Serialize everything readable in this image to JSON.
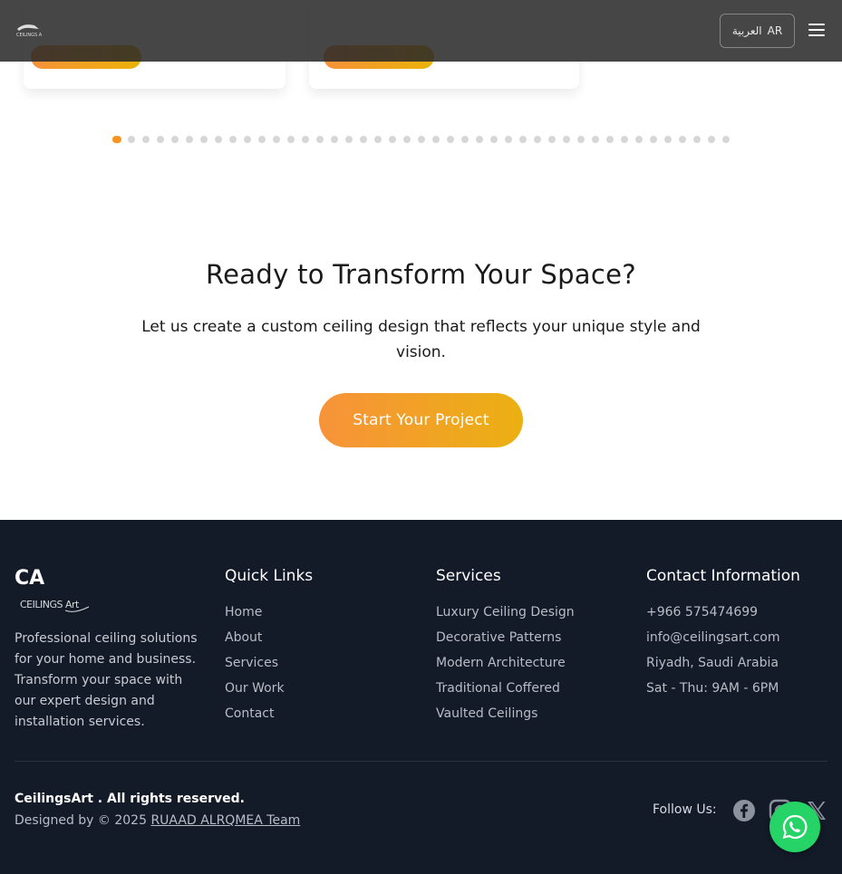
{
  "header": {
    "lang_button": {
      "ar_label": "العربية",
      "code": "AR"
    }
  },
  "carousel": {
    "dot_count": 43,
    "active_index": 0,
    "accent": "#f7931e"
  },
  "cta": {
    "title": "Ready to Transform Your Space?",
    "text": "Let us create a custom ceiling design that reflects your unique style and vision.",
    "button_label": "Start Your Project"
  },
  "footer": {
    "logo": {
      "ca": "CA",
      "brand": "CEILINGS Art"
    },
    "description": "Professional ceiling solutions for your home and business. Transform your space with our expert design and installation services.",
    "quick_links": {
      "heading": "Quick Links",
      "items": [
        "Home",
        "About",
        "Services",
        "Our Work",
        "Contact"
      ]
    },
    "services": {
      "heading": "Services",
      "items": [
        "Luxury Ceiling Design",
        "Decorative Patterns",
        "Modern Architecture",
        "Traditional Coffered",
        "Vaulted Ceilings"
      ]
    },
    "contact": {
      "heading": "Contact Information",
      "items": [
        "+966 575474699",
        "info@ceilingsart.com",
        "Riyadh, Saudi Arabia",
        "Sat - Thu: 9AM - 6PM"
      ]
    },
    "rights": "CeilingsArt . All rights reserved.",
    "designed_prefix": "Designed by © 2025",
    "designer": "RUAAD ALRQMEA Team",
    "follow_label": "Follow Us:",
    "social_icons": [
      "facebook-icon",
      "instagram-icon",
      "x-icon"
    ]
  },
  "colors": {
    "accent_orange": "#f7931e",
    "footer_bg": "#131a28",
    "whatsapp": "#25d366"
  }
}
